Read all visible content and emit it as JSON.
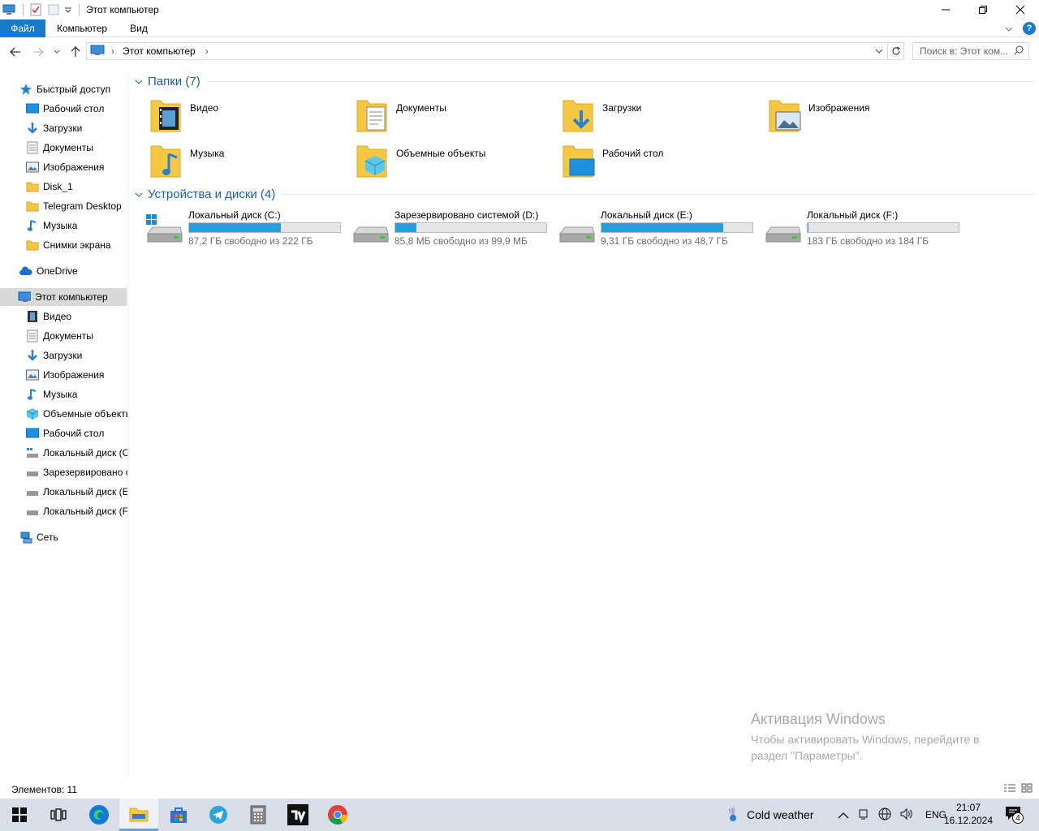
{
  "window": {
    "title": "Этот компьютер"
  },
  "ribbon": {
    "tabs": [
      "Файл",
      "Компьютер",
      "Вид"
    ]
  },
  "address": {
    "path": "Этот компьютер",
    "search_placeholder": "Поиск в: Этот ком..."
  },
  "sidebar": {
    "quick_access": "Быстрый доступ",
    "quick_items": [
      {
        "label": "Рабочий стол",
        "icon": "desktop-icon",
        "pinned": true
      },
      {
        "label": "Загрузки",
        "icon": "download-icon",
        "pinned": true
      },
      {
        "label": "Документы",
        "icon": "document-icon",
        "pinned": true
      },
      {
        "label": "Изображения",
        "icon": "pictures-icon",
        "pinned": true
      },
      {
        "label": "Disk_1",
        "icon": "folder-icon",
        "pinned": false
      },
      {
        "label": "Telegram Desktop",
        "icon": "folder-icon",
        "pinned": false
      },
      {
        "label": "Музыка",
        "icon": "music-icon",
        "pinned": false
      },
      {
        "label": "Снимки экрана",
        "icon": "folder-icon",
        "pinned": false
      }
    ],
    "onedrive": "OneDrive",
    "this_pc": "Этот компьютер",
    "pc_items": [
      {
        "label": "Видео",
        "icon": "video-icon"
      },
      {
        "label": "Документы",
        "icon": "document-icon"
      },
      {
        "label": "Загрузки",
        "icon": "download-icon"
      },
      {
        "label": "Изображения",
        "icon": "pictures-icon"
      },
      {
        "label": "Музыка",
        "icon": "music-icon"
      },
      {
        "label": "Объемные объекты",
        "icon": "3d-objects-icon"
      },
      {
        "label": "Рабочий стол",
        "icon": "desktop-icon"
      },
      {
        "label": "Локальный диск (C:)",
        "icon": "drive-icon"
      },
      {
        "label": "Зарезервировано системой (D:)",
        "icon": "drive-icon"
      },
      {
        "label": "Локальный диск (E:)",
        "icon": "drive-icon"
      },
      {
        "label": "Локальный диск (F:)",
        "icon": "drive-icon"
      }
    ],
    "network": "Сеть"
  },
  "main": {
    "folders_title": "Папки (7)",
    "folders": [
      {
        "label": "Видео",
        "icon": "video-folder-icon"
      },
      {
        "label": "Документы",
        "icon": "documents-folder-icon"
      },
      {
        "label": "Загрузки",
        "icon": "downloads-folder-icon"
      },
      {
        "label": "Изображения",
        "icon": "pictures-folder-icon"
      },
      {
        "label": "Музыка",
        "icon": "music-folder-icon"
      },
      {
        "label": "Объемные объекты",
        "icon": "3d-objects-folder-icon"
      },
      {
        "label": "Рабочий стол",
        "icon": "desktop-folder-icon"
      }
    ],
    "drives_title": "Устройства и диски (4)",
    "drives": [
      {
        "label": "Локальный диск (C:)",
        "free": "87,2 ГБ свободно из 222 ГБ",
        "used_fraction": 0.607,
        "system": true
      },
      {
        "label": "Зарезервировано системой (D:)",
        "free": "85,8 МБ свободно из 99,9 МБ",
        "used_fraction": 0.141,
        "system": false
      },
      {
        "label": "Локальный диск (E:)",
        "free": "9,31 ГБ свободно из 48,7 ГБ",
        "used_fraction": 0.809,
        "system": false
      },
      {
        "label": "Локальный диск (F:)",
        "free": "183 ГБ свободно из 184 ГБ",
        "used_fraction": 0.005,
        "system": false
      }
    ]
  },
  "watermark": {
    "title": "Активация Windows",
    "text": "Чтобы активировать Windows, перейдите в раздел \"Параметры\"."
  },
  "status": {
    "items_count": "Элементов: 11"
  },
  "taskbar": {
    "weather": "Cold weather",
    "lang": "ENG",
    "time": "21:07",
    "date": "16.12.2024",
    "notifications": "4"
  },
  "colors": {
    "accent": "#1979ca",
    "group_title": "#1c5fa6",
    "drive_bar": "#26a0da",
    "taskbar": "#d8dde8"
  }
}
